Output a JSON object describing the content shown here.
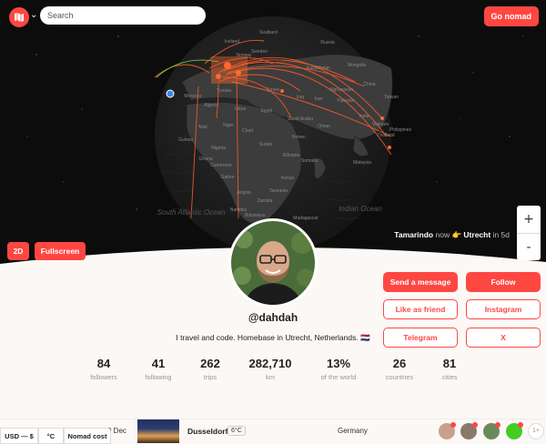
{
  "header": {
    "search_placeholder": "Search",
    "cta_label": "Go nomad"
  },
  "globe": {
    "labels": {
      "iceland": "Iceland",
      "svalbard": "Svalbard",
      "russia": "Russia",
      "kazakhstan": "Kazakhstan",
      "mongolia": "Mongolia",
      "china": "China",
      "india": "India",
      "taiwan": "Taiwan",
      "pakistan": "Pakistan",
      "afghanistan": "Afghanistan",
      "iran": "Iran",
      "iraq": "Iraq",
      "saudi_arabia": "Saudi Arabia",
      "egypt": "Egypt",
      "libya": "Libya",
      "algeria": "Algeria",
      "mali": "Mali",
      "niger": "Niger",
      "chad": "Chad",
      "sudan": "Sudan",
      "ethiopia": "Ethiopia",
      "somalia": "Somalia",
      "nigeria": "Nigeria",
      "cameroon": "Cameroon",
      "gabon": "Gabon",
      "kenya": "Kenya",
      "tanzania": "Tanzania",
      "angola": "Angola",
      "namibia": "Namibia",
      "zambia": "Zambia",
      "botswana": "Botswana",
      "madagascar": "Madagascar",
      "thailand": "Thailand",
      "malaysia": "Malaysia",
      "yemen": "Yemen",
      "oman": "Oman",
      "turkey": "Turkey",
      "tunisia": "Tunisia",
      "morocco": "Morocco",
      "guinea": "Guinea",
      "ghana": "Ghana",
      "south_atlantic": "South Atlantic Ocean",
      "indian_ocean": "Indian Ocean",
      "norway": "Norway",
      "sweden": "Sweden",
      "philippines": "Philippines",
      "vietnam": "Vietnam"
    },
    "view_2d_label": "2D",
    "fullscreen_label": "Fullscreen",
    "zoom_in_label": "+",
    "zoom_out_label": "-",
    "status": {
      "from_city": "Tamarindo",
      "now_word": "now",
      "arrow_emoji": "👉",
      "to_city": "Utrecht",
      "in_text": "in 5d"
    }
  },
  "profile": {
    "username": "@dahdah",
    "bio": "I travel and code. Homebase in Utrecht, Netherlands. 🇳🇱"
  },
  "actions": {
    "send_message": "Send a message",
    "follow": "Follow",
    "like_as_friend": "Like as friend",
    "instagram": "Instagram",
    "telegram": "Telegram",
    "x": "X"
  },
  "stats": [
    {
      "value": "84",
      "label": "followers"
    },
    {
      "value": "41",
      "label": "following"
    },
    {
      "value": "262",
      "label": "trips"
    },
    {
      "value": "282,710",
      "label": "km"
    },
    {
      "value": "13%",
      "label": "of the world"
    },
    {
      "value": "26",
      "label": "countries"
    },
    {
      "value": "81",
      "label": "cities"
    }
  ],
  "trip": {
    "date": "0 Dec",
    "city": "Dusseldorf",
    "temp": "6°C",
    "country": "Germany",
    "more": "1+"
  },
  "bottom_pills": {
    "currency": "USD — $",
    "temperature_unit": "°C",
    "nomad_cost": "Nomad cost"
  },
  "colors": {
    "brand": "#ff4742",
    "globe_bg": "#0c0c0c",
    "land": "#3a3a3a",
    "route": "#ff5a28"
  }
}
